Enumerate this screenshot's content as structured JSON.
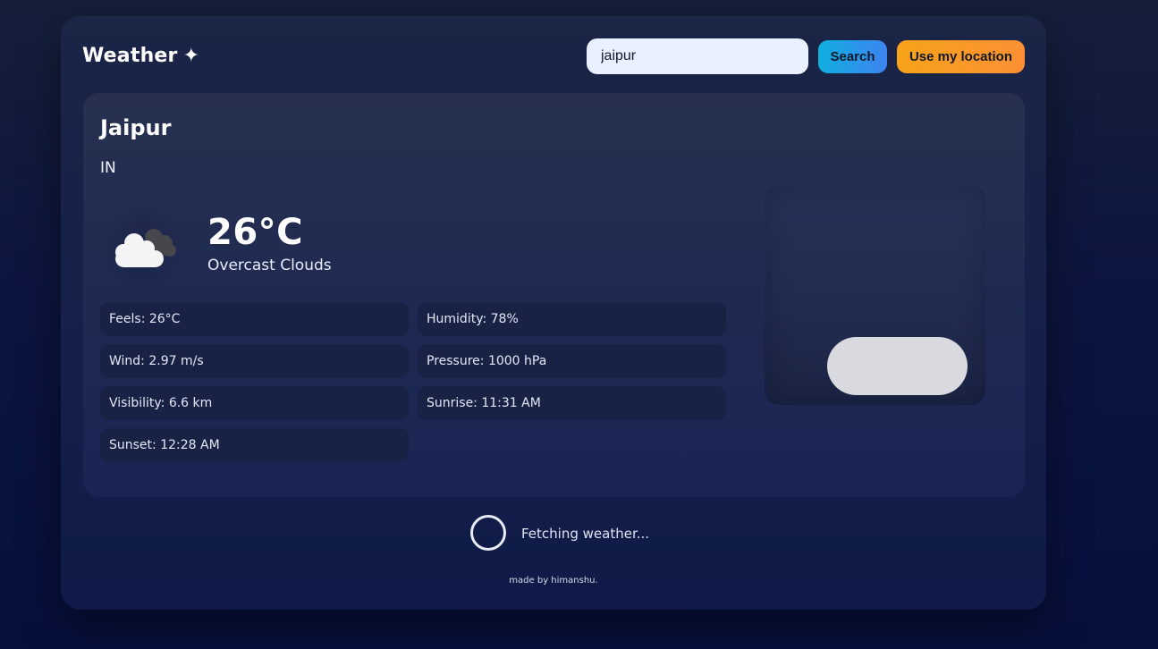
{
  "header": {
    "title": "Weather",
    "sparkle": "✦"
  },
  "search": {
    "value": "jaipur",
    "search_label": "Search",
    "location_label": "Use my location"
  },
  "weather": {
    "city": "Jaipur",
    "country": "IN",
    "icon": "cloud-icon",
    "temperature": "26°C",
    "description": "Overcast Clouds",
    "stats": [
      "Feels: 26°C",
      "Humidity: 78%",
      "Wind: 2.97 m/s",
      "Pressure: 1000 hPa",
      "Visibility: 6.6 km",
      "Sunrise: 11:31 AM",
      "Sunset: 12:28 AM"
    ]
  },
  "status": {
    "loading_text": "Fetching weather..."
  },
  "footer": {
    "credit": "made by himanshu."
  },
  "colors": {
    "search_button": "#10aee0",
    "location_button": "#f7a21a",
    "input_background": "#e9f0ff"
  }
}
